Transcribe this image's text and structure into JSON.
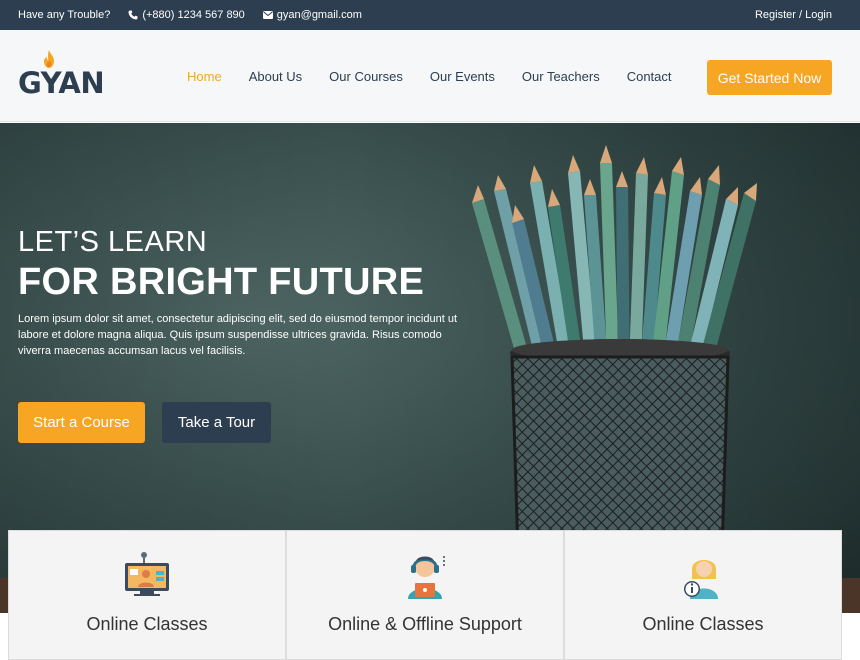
{
  "topbar": {
    "trouble": "Have any Trouble?",
    "phone": "(+880) 1234 567 890",
    "email": "gyan@gmail.com",
    "auth": "Register / Login"
  },
  "brand": {
    "name": "GYAN",
    "accent": "#f6a623",
    "dark": "#2c3e50"
  },
  "nav": {
    "items": [
      {
        "label": "Home",
        "active": true
      },
      {
        "label": "About Us"
      },
      {
        "label": "Our Courses"
      },
      {
        "label": "Our Events"
      },
      {
        "label": "Our Teachers"
      },
      {
        "label": "Contact"
      }
    ],
    "cta": "Get Started Now"
  },
  "hero": {
    "subtitle": "LET’S LEARN",
    "title": "FOR BRIGHT FUTURE",
    "description": "Lorem ipsum dolor sit amet, consectetur adipiscing elit, sed do eiusmod tempor incidunt ut labore et dolore magna aliqua. Quis ipsum suspendisse ultrices gravida. Risus comodo viverra maecenas accumsan lacus vel facilisis.",
    "primary_button": "Start a Course",
    "secondary_button": "Take a Tour"
  },
  "features": [
    {
      "label": "Online Classes",
      "icon": "online-class-icon"
    },
    {
      "label": "Online & Offline Support",
      "icon": "support-agent-icon"
    },
    {
      "label": "Online Classes",
      "icon": "info-person-icon"
    }
  ]
}
